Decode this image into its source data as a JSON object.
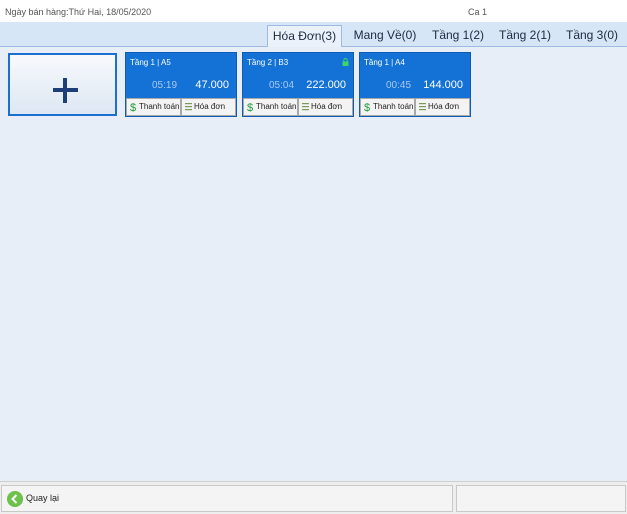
{
  "header": {
    "date": "Ngày bán hàng:Thứ Hai, 18/05/2020",
    "shift": "Ca 1"
  },
  "tabs": [
    {
      "label": "Hóa Đơn(3)",
      "active": true
    },
    {
      "label": "Mang Về(0)",
      "active": false
    },
    {
      "label": "Tầng 1(2)",
      "active": false
    },
    {
      "label": "Tầng 2(1)",
      "active": false
    },
    {
      "label": "Tầng 3(0)",
      "active": false
    }
  ],
  "add_card": {
    "icon": "plus-icon"
  },
  "orders": [
    {
      "table": "Tầng 1 | A5",
      "time": "05:19",
      "amount": "47.000",
      "locked": false,
      "pay_label": "Thanh toán",
      "invoice_label": "Hóa đơn"
    },
    {
      "table": "Tầng 2 | B3",
      "time": "05:04",
      "amount": "222.000",
      "locked": true,
      "pay_label": "Thanh toán",
      "invoice_label": "Hóa đơn"
    },
    {
      "table": "Tầng 1 | A4",
      "time": "00:45",
      "amount": "144.000",
      "locked": false,
      "pay_label": "Thanh toán",
      "invoice_label": "Hóa đơn"
    }
  ],
  "footer": {
    "back_label": "Quay lại"
  },
  "colors": {
    "card": "#1472d6",
    "tabstrip": "#d7e6f7",
    "main_bg": "#e8eef8",
    "back_icon": "#6cc24a"
  }
}
